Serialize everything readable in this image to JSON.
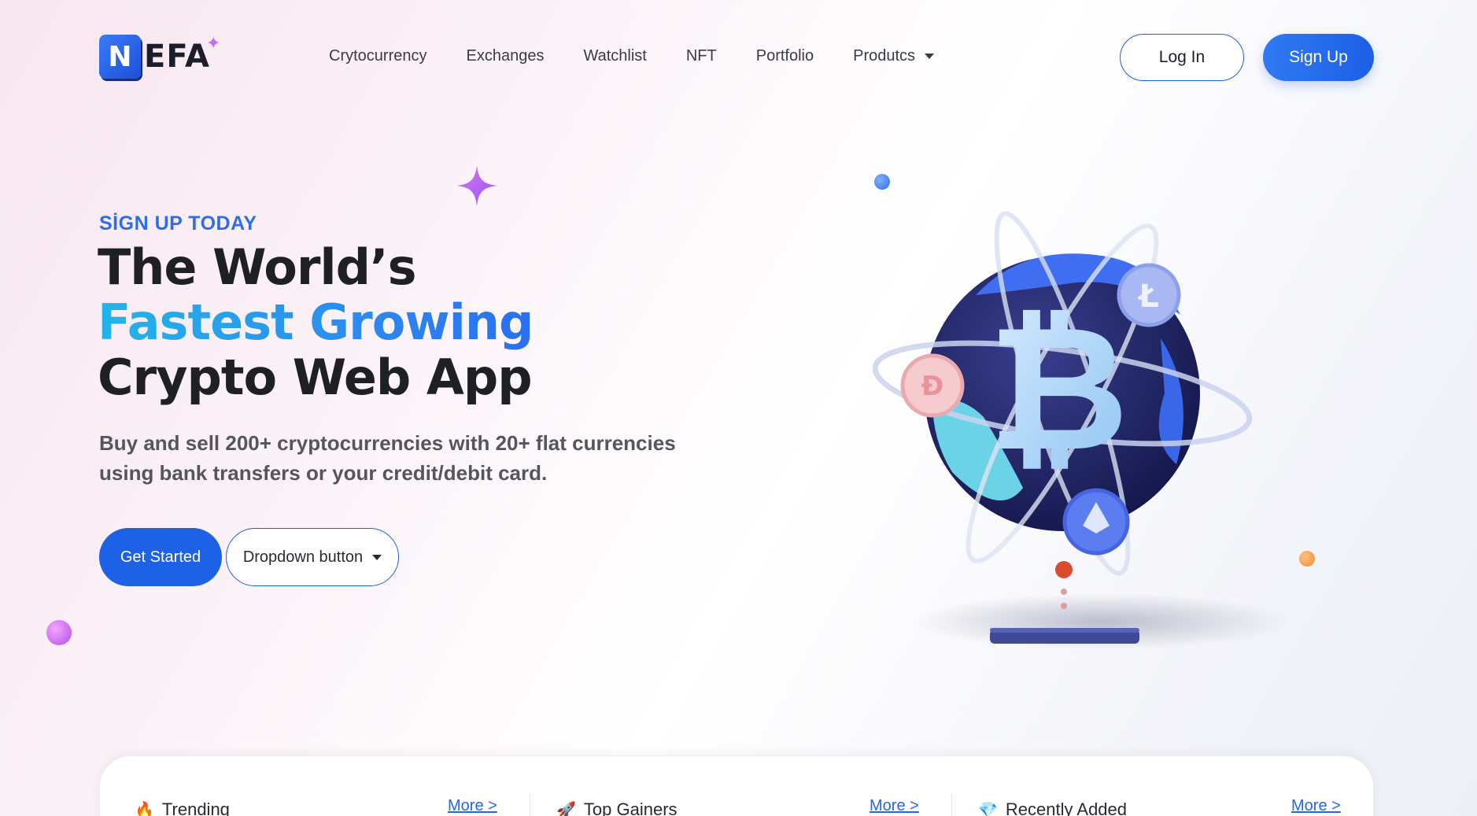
{
  "brand": {
    "logo_letter": "N",
    "logo_text": "EFA"
  },
  "nav": {
    "items": [
      "Crytocurrency",
      "Exchanges",
      "Watchlist",
      "NFT",
      "Portfolio",
      "Produtcs"
    ]
  },
  "auth": {
    "login_label": "Log In",
    "signup_label": "Sign Up"
  },
  "hero": {
    "eyebrow": "SİGN UP TODAY",
    "title_line1": "The World’s",
    "title_line2": "Fastest Growing",
    "title_line3": "Crypto Web App",
    "description": "Buy and sell 200+ cryptocurrencies with 20+ flat currencies using bank transfers or your credit/debit card.",
    "cta_primary": "Get Started",
    "cta_dropdown": "Dropdown button"
  },
  "market_tabs": [
    {
      "icon": "fire-icon",
      "title": "Trending",
      "more": "More >"
    },
    {
      "icon": "rocket-icon",
      "title": "Top Gainers",
      "more": "More >"
    },
    {
      "icon": "diamond-icon",
      "title": "Recently Added",
      "more": "More >"
    }
  ],
  "colors": {
    "primary": "#1d62e6",
    "accent_gradient_start": "#22b5e8",
    "accent_gradient_end": "#2a6ff0",
    "eyebrow": "#2d6ee8"
  }
}
